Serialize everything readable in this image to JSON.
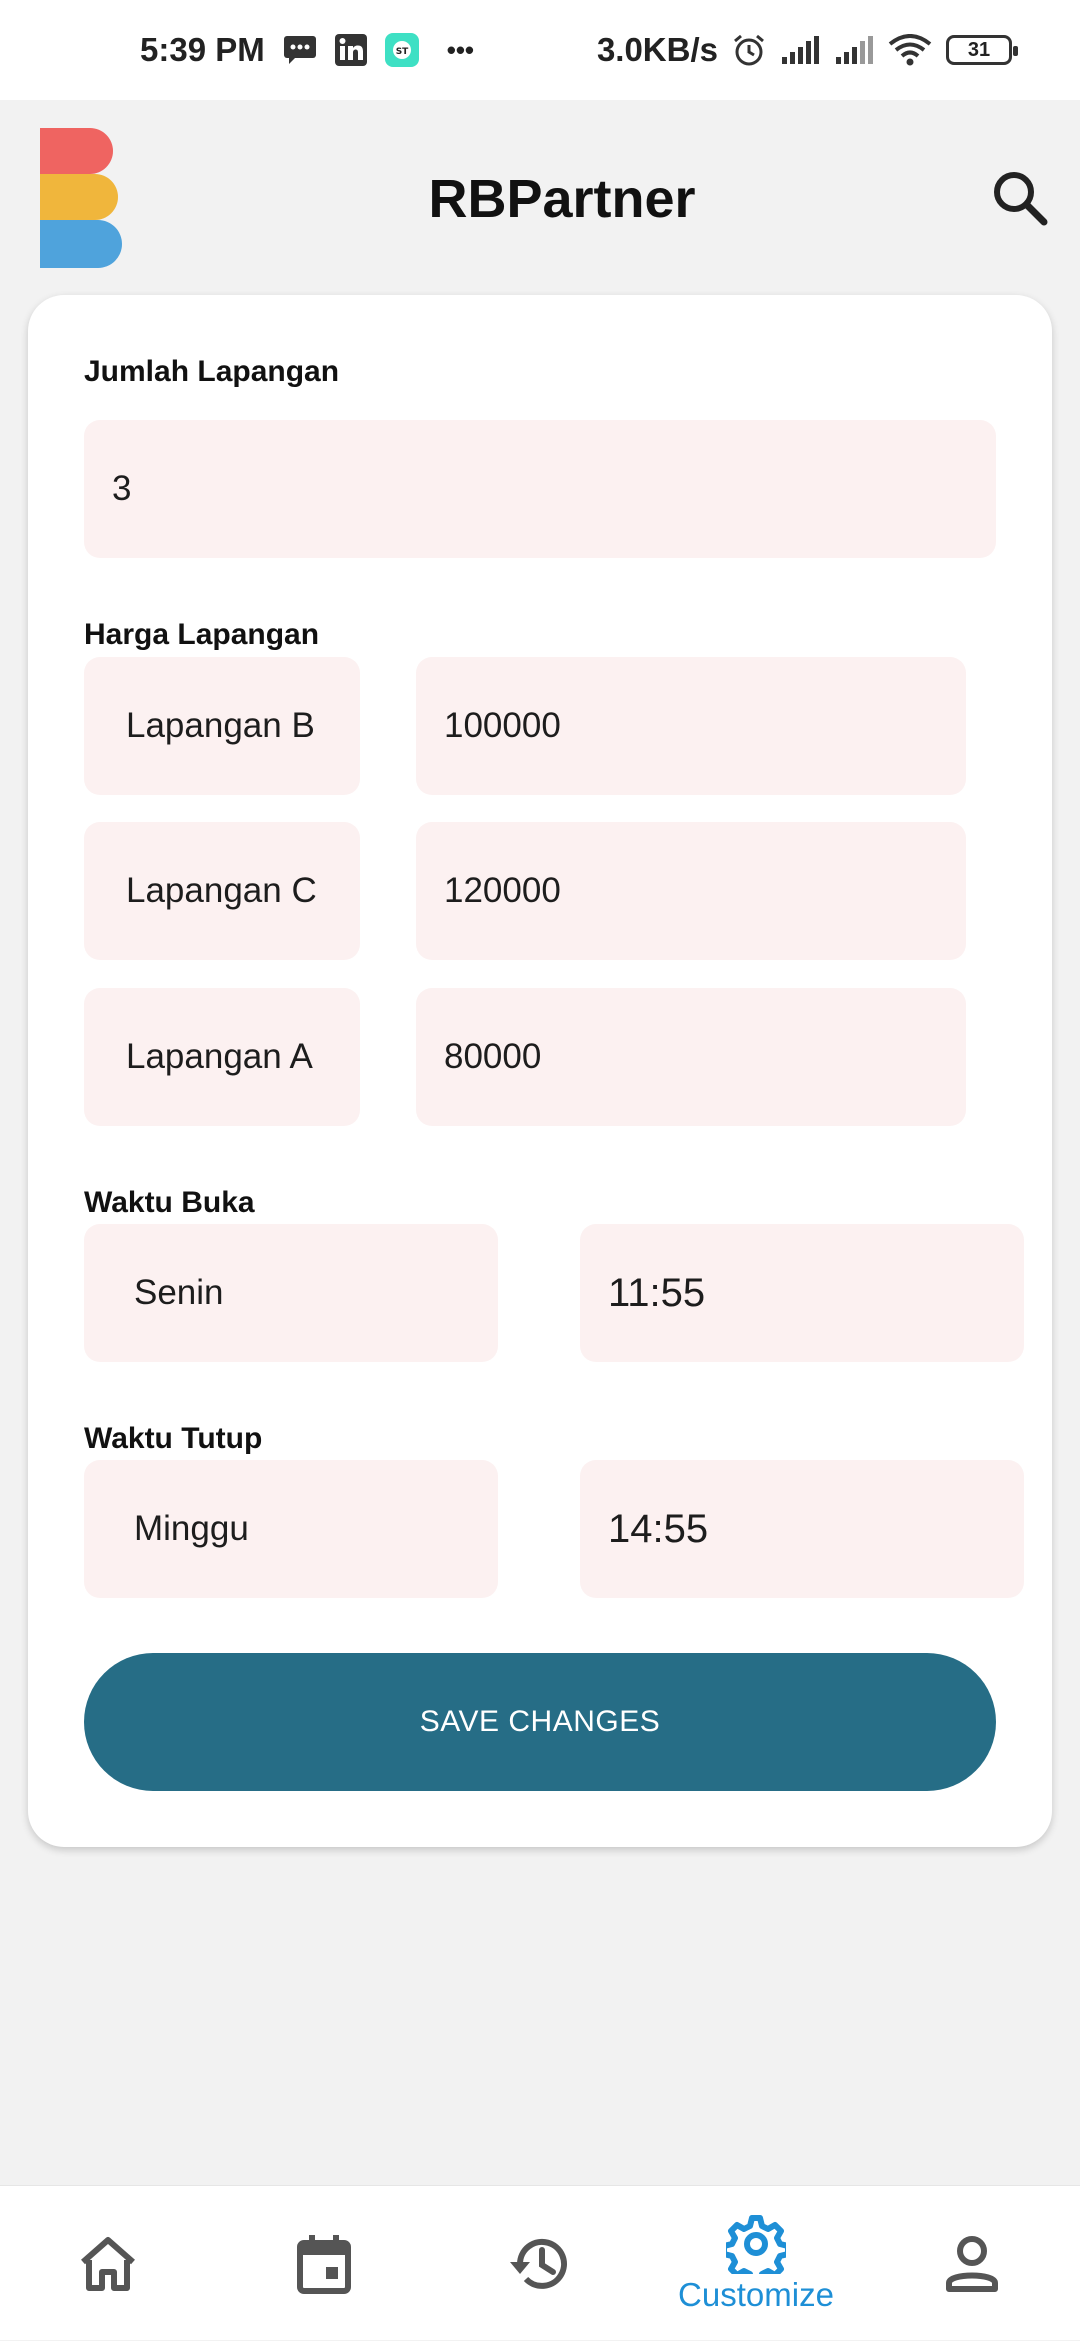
{
  "status_bar": {
    "time": "5:39 PM",
    "network_speed": "3.0KB/s",
    "battery": "31",
    "more": "•••"
  },
  "app": {
    "title": "RBPartner"
  },
  "form": {
    "jumlah_label": "Jumlah Lapangan",
    "jumlah_value": "3",
    "harga_label": "Harga Lapangan",
    "courts": [
      {
        "name": "Lapangan B",
        "price": "100000"
      },
      {
        "name": "Lapangan C",
        "price": "120000"
      },
      {
        "name": "Lapangan A",
        "price": "80000"
      }
    ],
    "buka_label": "Waktu Buka",
    "buka_day": "Senin",
    "buka_time": "11:55",
    "tutup_label": "Waktu Tutup",
    "tutup_day": "Minggu",
    "tutup_time": "14:55",
    "save_label": "SAVE CHANGES"
  },
  "nav": {
    "items": [
      {
        "icon": "home-icon",
        "label": ""
      },
      {
        "icon": "calendar-icon",
        "label": ""
      },
      {
        "icon": "history-icon",
        "label": ""
      },
      {
        "icon": "gear-icon",
        "label": "Customize",
        "active": true
      },
      {
        "icon": "person-icon",
        "label": ""
      }
    ],
    "active_color": "#1e8fd6",
    "inactive_color": "#555555"
  },
  "colors": {
    "logo_red": "#ef6461",
    "logo_yellow": "#f0b63c",
    "logo_blue": "#4fa3dc",
    "field_bg": "#fcf1f1",
    "button": "#266d86"
  }
}
